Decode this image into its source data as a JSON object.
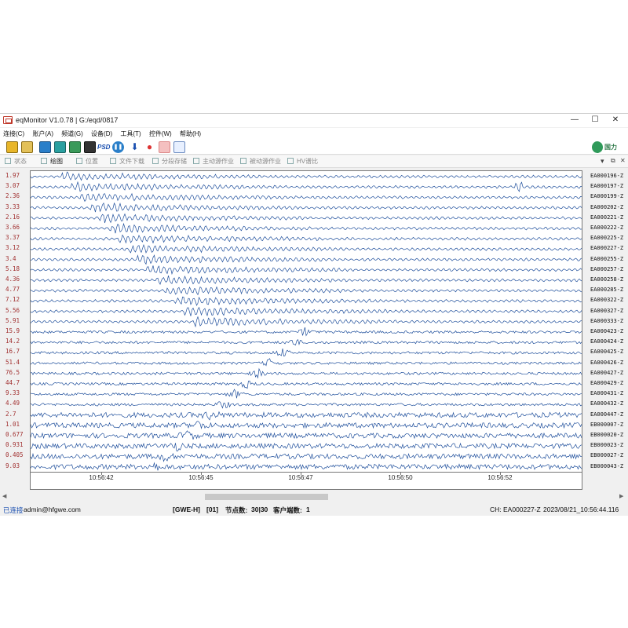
{
  "window": {
    "title": "eqMonitor V1.0.78 | G:/eqd/0817",
    "minimize": "—",
    "maximize": "☐",
    "close": "✕"
  },
  "menu": [
    "连接(C)",
    "账户(A)",
    "频道(G)",
    "设备(D)",
    "工具(T)",
    "控件(W)",
    "帮助(H)"
  ],
  "toolbar": {
    "psd_label": "PSD",
    "brand_label": "国力"
  },
  "tabs": [
    {
      "label": "状态",
      "active": false
    },
    {
      "label": "绘图",
      "active": true
    },
    {
      "label": "位置",
      "active": false
    },
    {
      "label": "文件下载",
      "active": false
    },
    {
      "label": "分段存储",
      "active": false
    },
    {
      "label": "主动源作业",
      "active": false
    },
    {
      "label": "被动源作业",
      "active": false
    },
    {
      "label": "HV谱比",
      "active": false
    }
  ],
  "channels": [
    {
      "scale": "1.97",
      "label": "EA000196-Z"
    },
    {
      "scale": "3.07",
      "label": "EA000197-Z"
    },
    {
      "scale": "2.36",
      "label": "EA000199-Z"
    },
    {
      "scale": "3.33",
      "label": "EA000202-Z"
    },
    {
      "scale": "2.16",
      "label": "EA000221-Z"
    },
    {
      "scale": "3.66",
      "label": "EA000222-Z"
    },
    {
      "scale": "3.37",
      "label": "EA000225-Z"
    },
    {
      "scale": "3.12",
      "label": "EA000227-Z"
    },
    {
      "scale": "3.4",
      "label": "EA000255-Z"
    },
    {
      "scale": "5.18",
      "label": "EA000257-Z"
    },
    {
      "scale": "4.36",
      "label": "EA000258-Z"
    },
    {
      "scale": "4.77",
      "label": "EA000285-Z"
    },
    {
      "scale": "7.12",
      "label": "EA000322-Z"
    },
    {
      "scale": "5.56",
      "label": "EA000327-Z"
    },
    {
      "scale": "5.91",
      "label": "EA000333-Z"
    },
    {
      "scale": "15.9",
      "label": "EA000423-Z"
    },
    {
      "scale": "14.2",
      "label": "EA000424-Z"
    },
    {
      "scale": "16.7",
      "label": "EA000425-Z"
    },
    {
      "scale": "51.4",
      "label": "EA000426-Z"
    },
    {
      "scale": "76.5",
      "label": "EA000427-Z"
    },
    {
      "scale": "44.7",
      "label": "EA000429-Z"
    },
    {
      "scale": "9.33",
      "label": "EA000431-Z"
    },
    {
      "scale": "4.49",
      "label": "EA000432-Z"
    },
    {
      "scale": "2.7",
      "label": "EA000447-Z"
    },
    {
      "scale": "1.01",
      "label": "EB000007-Z"
    },
    {
      "scale": "0.677",
      "label": "EB000020-Z"
    },
    {
      "scale": "0.931",
      "label": "EB000023-Z"
    },
    {
      "scale": "0.405",
      "label": "EB000027-Z"
    },
    {
      "scale": "9.03",
      "label": "EB000043-Z"
    }
  ],
  "time_ticks": [
    "10:56:42",
    "10:56:45",
    "10:56:47",
    "10:56:50",
    "10:56:52"
  ],
  "colors": {
    "trace": "#1f4f9c",
    "scale_text": "#a13030",
    "status_connected": "#1a4fb0"
  },
  "status": {
    "connected": "已连接",
    "user": "admin@hfgwe.com",
    "group": "[GWE-H]",
    "index": "[01]",
    "nodes_label": "节点数:",
    "nodes_value": "30|30",
    "clients_label": "客户端数:",
    "clients_value": "1",
    "channel": "CH: EA000227-Z",
    "datetime": "2023/08/21_10:56:44.116"
  }
}
